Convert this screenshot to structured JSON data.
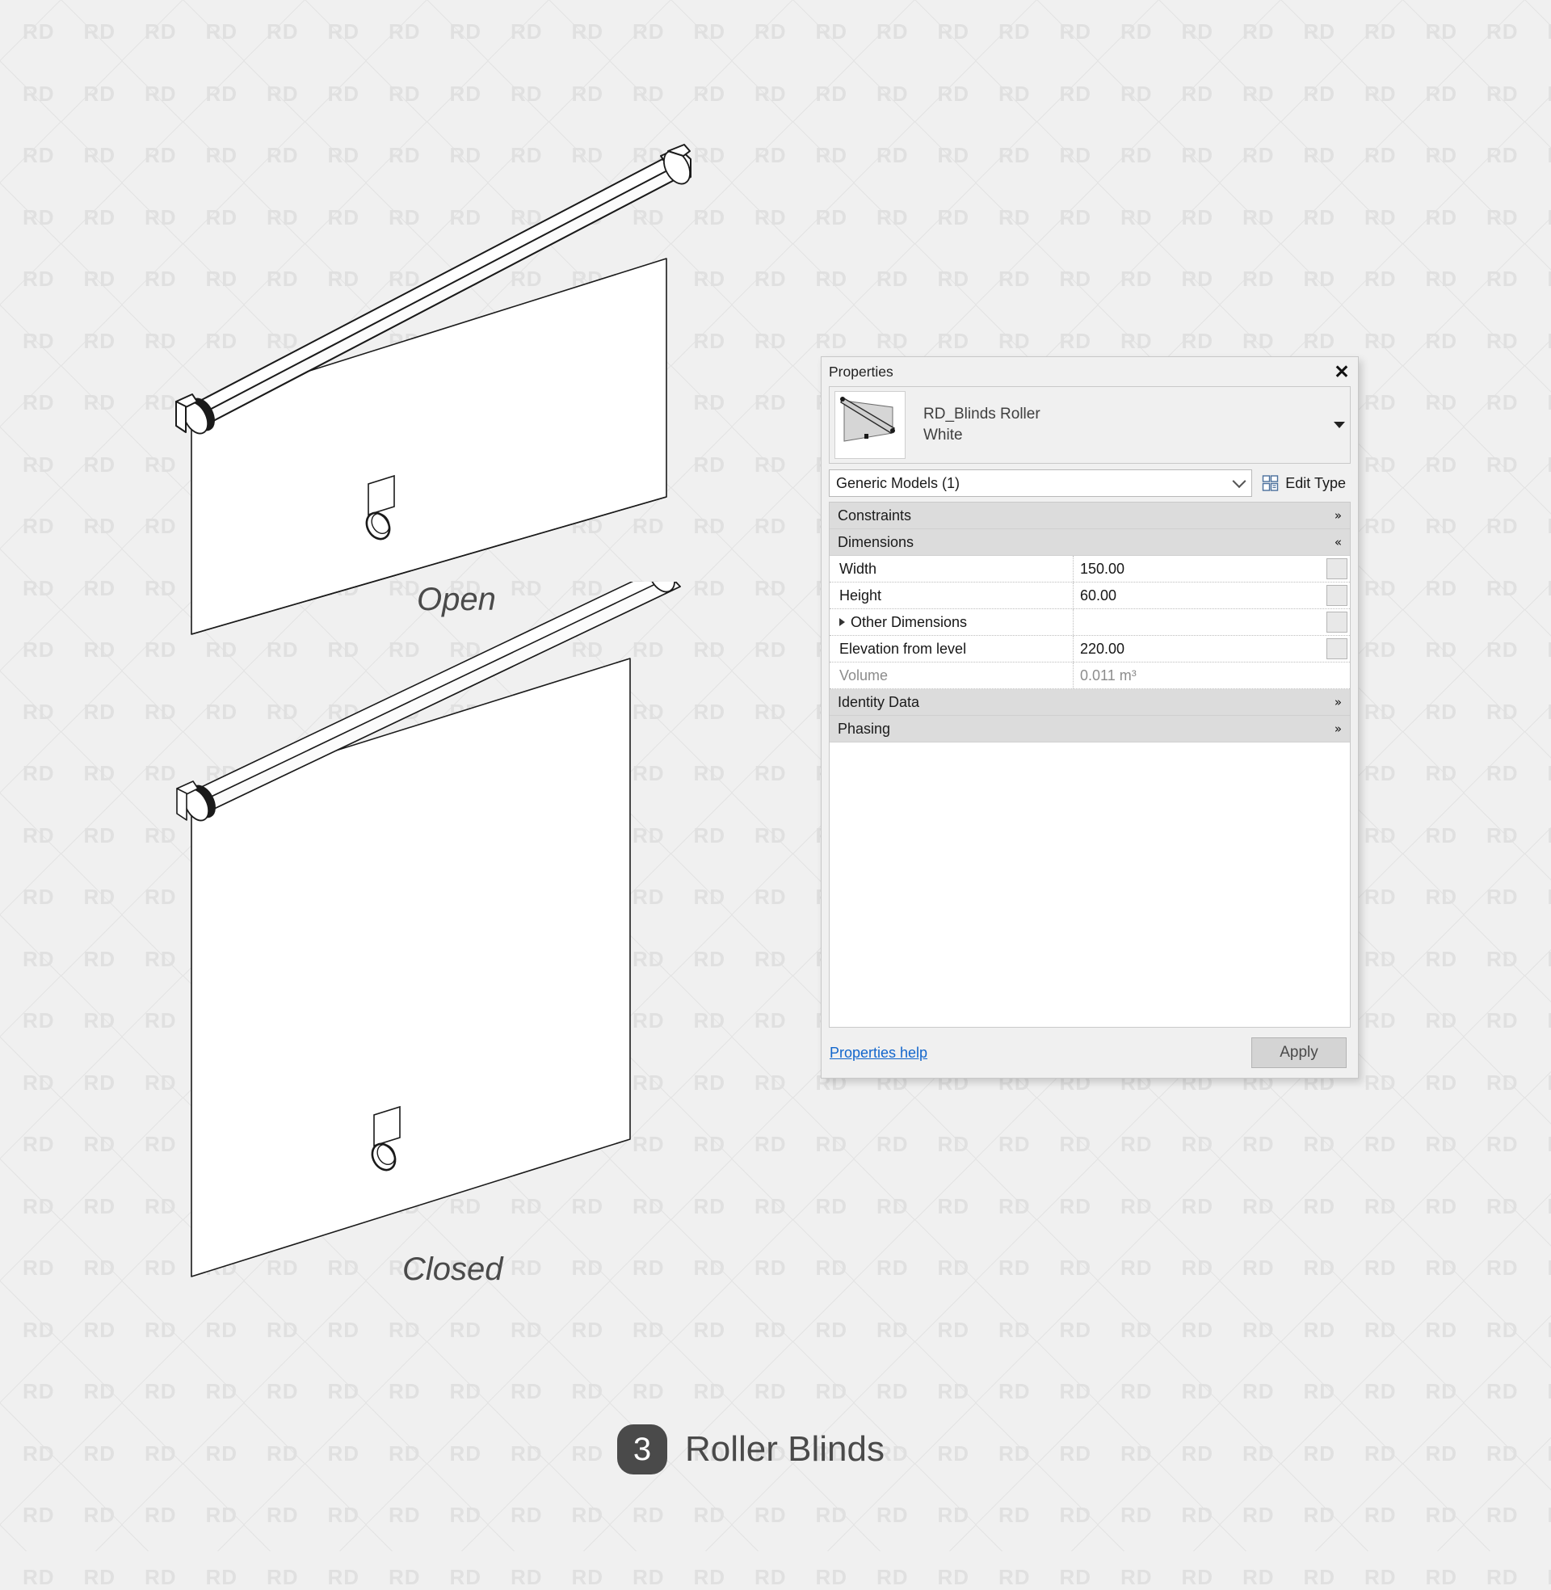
{
  "background": {
    "watermark_text": "RD",
    "bg_color": "#f0f0f0",
    "watermark_color": "#e0e0e0"
  },
  "drawings": {
    "open": {
      "label": "Open"
    },
    "closed": {
      "label": "Closed"
    }
  },
  "bottom_title": {
    "badge_number": "3",
    "title": "Roller Blinds"
  },
  "properties_panel": {
    "title": "Properties",
    "close_icon": "close-icon",
    "type_name_line1": "RD_Blinds Roller",
    "type_name_line2": "White",
    "category": "Generic Models (1)",
    "edit_type_label": "Edit Type",
    "sections": [
      {
        "name": "Constraints",
        "state": "collapsed",
        "chevron": "»"
      },
      {
        "name": "Dimensions",
        "state": "expanded",
        "chevron": "«"
      },
      {
        "name": "Identity Data",
        "state": "collapsed",
        "chevron": "»"
      },
      {
        "name": "Phasing",
        "state": "collapsed",
        "chevron": "»"
      }
    ],
    "parameters": [
      {
        "name": "Width",
        "value": "150.00",
        "readonly": false,
        "has_button": true,
        "expandable": false
      },
      {
        "name": "Height",
        "value": "60.00",
        "readonly": false,
        "has_button": true,
        "expandable": false
      },
      {
        "name": "Other Dimensions",
        "value": "",
        "readonly": false,
        "has_button": true,
        "expandable": true
      },
      {
        "name": "Elevation from level",
        "value": "220.00",
        "readonly": false,
        "has_button": true,
        "expandable": false
      },
      {
        "name": "Volume",
        "value": "0.011 m³",
        "readonly": true,
        "has_button": false,
        "expandable": false
      }
    ],
    "help_link": "Properties help",
    "apply_label": "Apply",
    "link_color": "#1266cc"
  }
}
